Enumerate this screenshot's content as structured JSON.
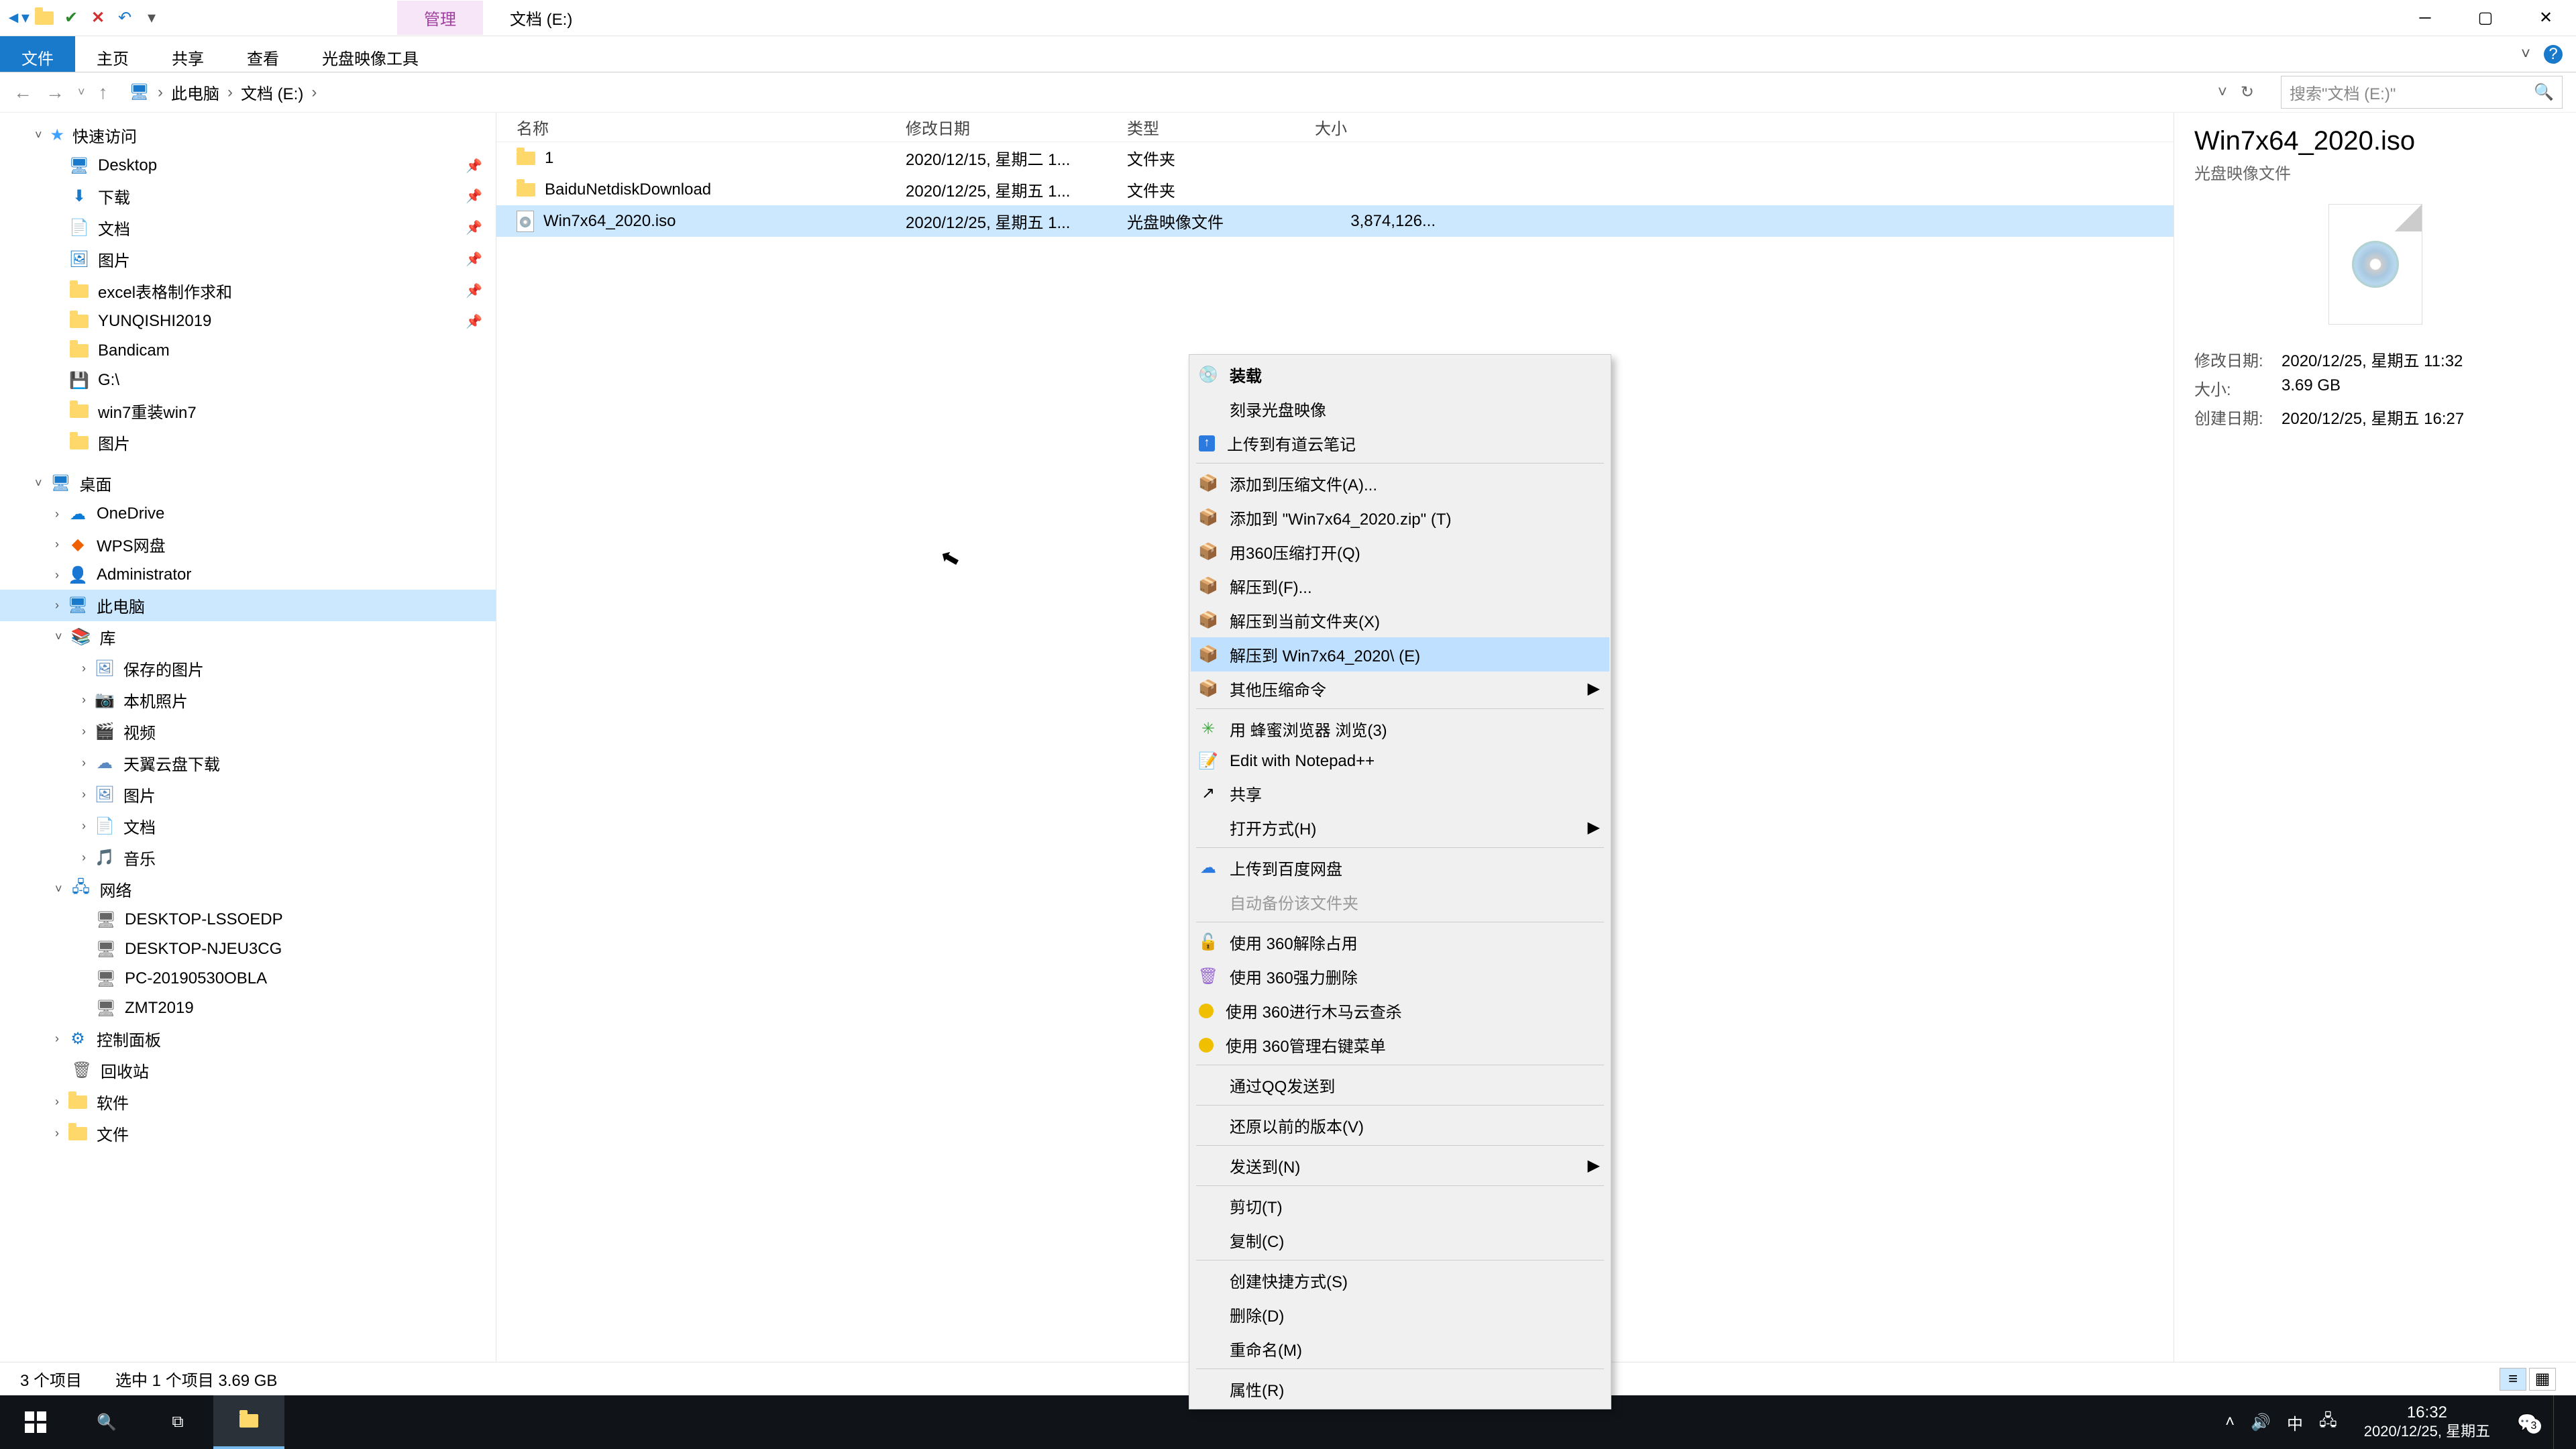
{
  "titleTabs": {
    "manage": "管理",
    "docTitle": "文档 (E:)"
  },
  "ribbon": {
    "file": "文件",
    "home": "主页",
    "share": "共享",
    "view": "查看",
    "isoTools": "光盘映像工具"
  },
  "address": {
    "thisPC": "此电脑",
    "drive": "文档 (E:)"
  },
  "search": {
    "placeholder": "搜索\"文档 (E:)\""
  },
  "columns": {
    "name": "名称",
    "date": "修改日期",
    "type": "类型",
    "size": "大小"
  },
  "files": [
    {
      "name": "1",
      "date": "2020/12/15, 星期二 1...",
      "type": "文件夹",
      "size": "",
      "kind": "folder"
    },
    {
      "name": "BaiduNetdiskDownload",
      "date": "2020/12/25, 星期五 1...",
      "type": "文件夹",
      "size": "",
      "kind": "folder"
    },
    {
      "name": "Win7x64_2020.iso",
      "date": "2020/12/25, 星期五 1...",
      "type": "光盘映像文件",
      "size": "3,874,126...",
      "kind": "iso"
    }
  ],
  "nav": {
    "quick": "快速访问",
    "quickItems": [
      "Desktop",
      "下载",
      "文档",
      "图片",
      "excel表格制作求和",
      "YUNQISHI2019",
      "Bandicam",
      "G:\\",
      "win7重装win7",
      "图片"
    ],
    "desktop": "桌面",
    "desktopItems": [
      "OneDrive",
      "WPS网盘",
      "Administrator",
      "此电脑",
      "库"
    ],
    "libItems": [
      "保存的图片",
      "本机照片",
      "视频",
      "天翼云盘下载",
      "图片",
      "文档",
      "音乐"
    ],
    "network": "网络",
    "netItems": [
      "DESKTOP-LSSOEDP",
      "DESKTOP-NJEU3CG",
      "PC-20190530OBLA",
      "ZMT2019"
    ],
    "controlPanel": "控制面板",
    "recycle": "回收站",
    "software": "软件",
    "filesFolder": "文件"
  },
  "details": {
    "title": "Win7x64_2020.iso",
    "subtitle": "光盘映像文件",
    "modLabel": "修改日期:",
    "modVal": "2020/12/25, 星期五 11:32",
    "sizeLabel": "大小:",
    "sizeVal": "3.69 GB",
    "createLabel": "创建日期:",
    "createVal": "2020/12/25, 星期五 16:27"
  },
  "ctx": {
    "mount": "装载",
    "burn": "刻录光盘映像",
    "youdao": "上传到有道云笔记",
    "addArchive": "添加到压缩文件(A)...",
    "addZip": "添加到 \"Win7x64_2020.zip\" (T)",
    "openWith360zip": "用360压缩打开(Q)",
    "extractTo": "解压到(F)...",
    "extractHere": "解压到当前文件夹(X)",
    "extractToFolder": "解压到 Win7x64_2020\\ (E)",
    "otherCompress": "其他压缩命令",
    "beeBrowser": "用 蜂蜜浏览器 浏览(3)",
    "notepadpp": "Edit with Notepad++",
    "share": "共享",
    "openWith": "打开方式(H)",
    "uploadBaidu": "上传到百度网盘",
    "autoBackup": "自动备份该文件夹",
    "unlock360": "使用 360解除占用",
    "forceDel360": "使用 360强力删除",
    "trojan360": "使用 360进行木马云查杀",
    "manage360": "使用 360管理右键菜单",
    "sendQQ": "通过QQ发送到",
    "restore": "还原以前的版本(V)",
    "sendTo": "发送到(N)",
    "cut": "剪切(T)",
    "copy": "复制(C)",
    "shortcut": "创建快捷方式(S)",
    "delete": "删除(D)",
    "rename": "重命名(M)",
    "properties": "属性(R)"
  },
  "status": {
    "count": "3 个项目",
    "selected": "选中 1 个项目  3.69 GB"
  },
  "taskbar": {
    "time": "16:32",
    "date": "2020/12/25, 星期五",
    "ime": "中",
    "notif": "3"
  }
}
